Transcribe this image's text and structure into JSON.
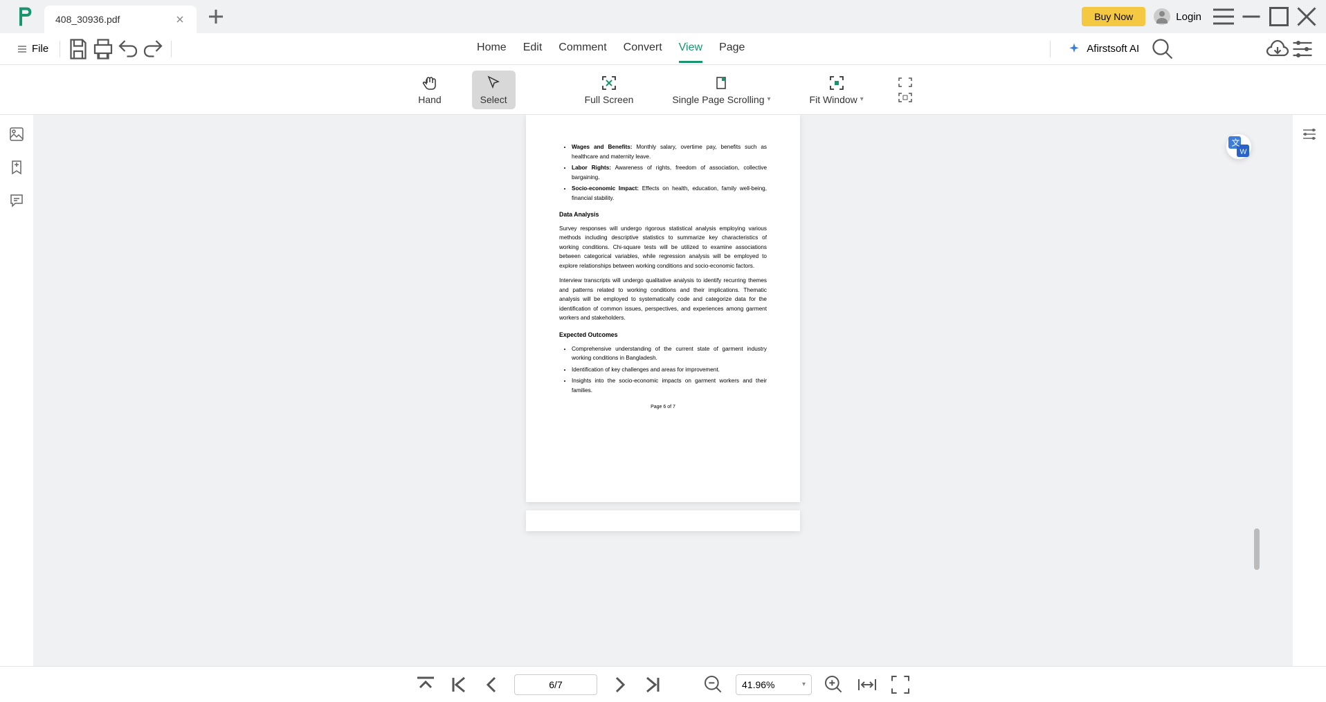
{
  "titlebar": {
    "tab_title": "408_30936.pdf",
    "buy_now": "Buy Now",
    "login": "Login"
  },
  "menubar": {
    "file": "File",
    "tabs": {
      "home": "Home",
      "edit": "Edit",
      "comment": "Comment",
      "convert": "Convert",
      "view": "View",
      "page": "Page"
    },
    "ai": "Afirstsoft AI"
  },
  "toolbar": {
    "hand": "Hand",
    "select": "Select",
    "fullscreen": "Full Screen",
    "single_page": "Single Page Scrolling",
    "fit_window": "Fit Window"
  },
  "document": {
    "bullets1": [
      {
        "bold": "Wages and Benefits:",
        "text": " Monthly salary, overtime pay, benefits such as healthcare and maternity leave."
      },
      {
        "bold": "Labor Rights:",
        "text": " Awareness of rights, freedom of association, collective bargaining."
      },
      {
        "bold": "Socio-economic Impact:",
        "text": " Effects on health, education, family well-being, financial stability."
      }
    ],
    "heading1": "Data Analysis",
    "para1": "Survey responses will undergo rigorous statistical analysis employing various methods including descriptive statistics to summarize key characteristics of working conditions. Chi-square tests will be utilized to examine associations between categorical variables, while regression analysis will be employed to explore relationships between working conditions and socio-economic factors.",
    "para2": "Interview transcripts will undergo qualitative analysis to identify recurring themes and patterns related to working conditions and their implications. Thematic analysis will be employed to systematically code and categorize data for the identification of common issues, perspectives, and experiences among garment workers and stakeholders.",
    "heading2": "Expected Outcomes",
    "bullets2": [
      "Comprehensive understanding of the current state of garment industry working conditions in Bangladesh.",
      "Identification of key challenges and areas for improvement.",
      "Insights into the socio-economic impacts on garment workers and their families."
    ],
    "page_number": "Page 6 of 7"
  },
  "bottombar": {
    "page": "6/7",
    "zoom": "41.96%"
  }
}
